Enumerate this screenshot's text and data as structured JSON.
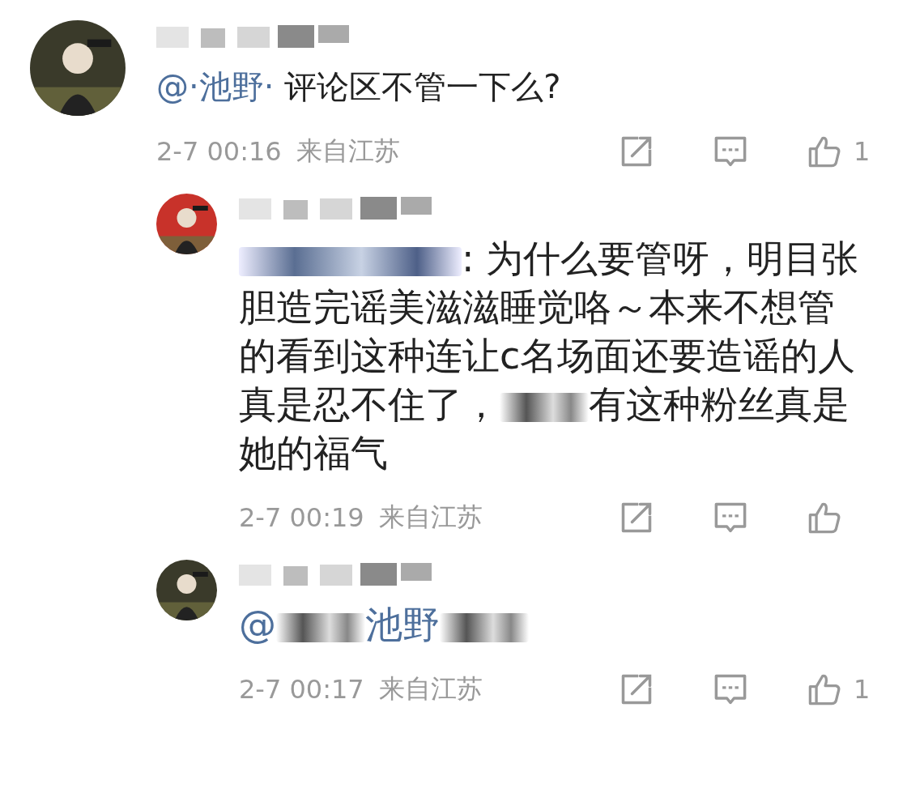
{
  "comments": [
    {
      "reply": false,
      "avatar": {
        "kind": "picture",
        "color": "#3a3a2a"
      },
      "body": [
        {
          "kind": "mention",
          "text": "@·池野·"
        },
        {
          "kind": "text",
          "text": " 评论区不管一下么?"
        }
      ],
      "time": "2-7 00:16",
      "location": "来自江苏",
      "likes": "1"
    },
    {
      "reply": true,
      "avatar": {
        "kind": "picture",
        "color": "#c8322a"
      },
      "body": [
        {
          "kind": "redacted_mention"
        },
        {
          "kind": "text",
          "text": ": 为什么要管呀，明目张胆造完谣美滋滋睡觉咯～本来不想管的看到这种连让c名场面还要造谣的人真是忍不住了，"
        },
        {
          "kind": "redacted"
        },
        {
          "kind": "text",
          "text": "有这种粉丝真是她的福气"
        }
      ],
      "time": "2-7 00:19",
      "location": "来自江苏"
    },
    {
      "reply": true,
      "avatar": {
        "kind": "picture",
        "color": "#3a3a2a"
      },
      "body": [
        {
          "kind": "mention",
          "text": "@"
        },
        {
          "kind": "redacted"
        },
        {
          "kind": "mention",
          "text": "池野"
        },
        {
          "kind": "redacted"
        }
      ],
      "time": "2-7 00:17",
      "location": "来自江苏",
      "likes": "1"
    }
  ]
}
